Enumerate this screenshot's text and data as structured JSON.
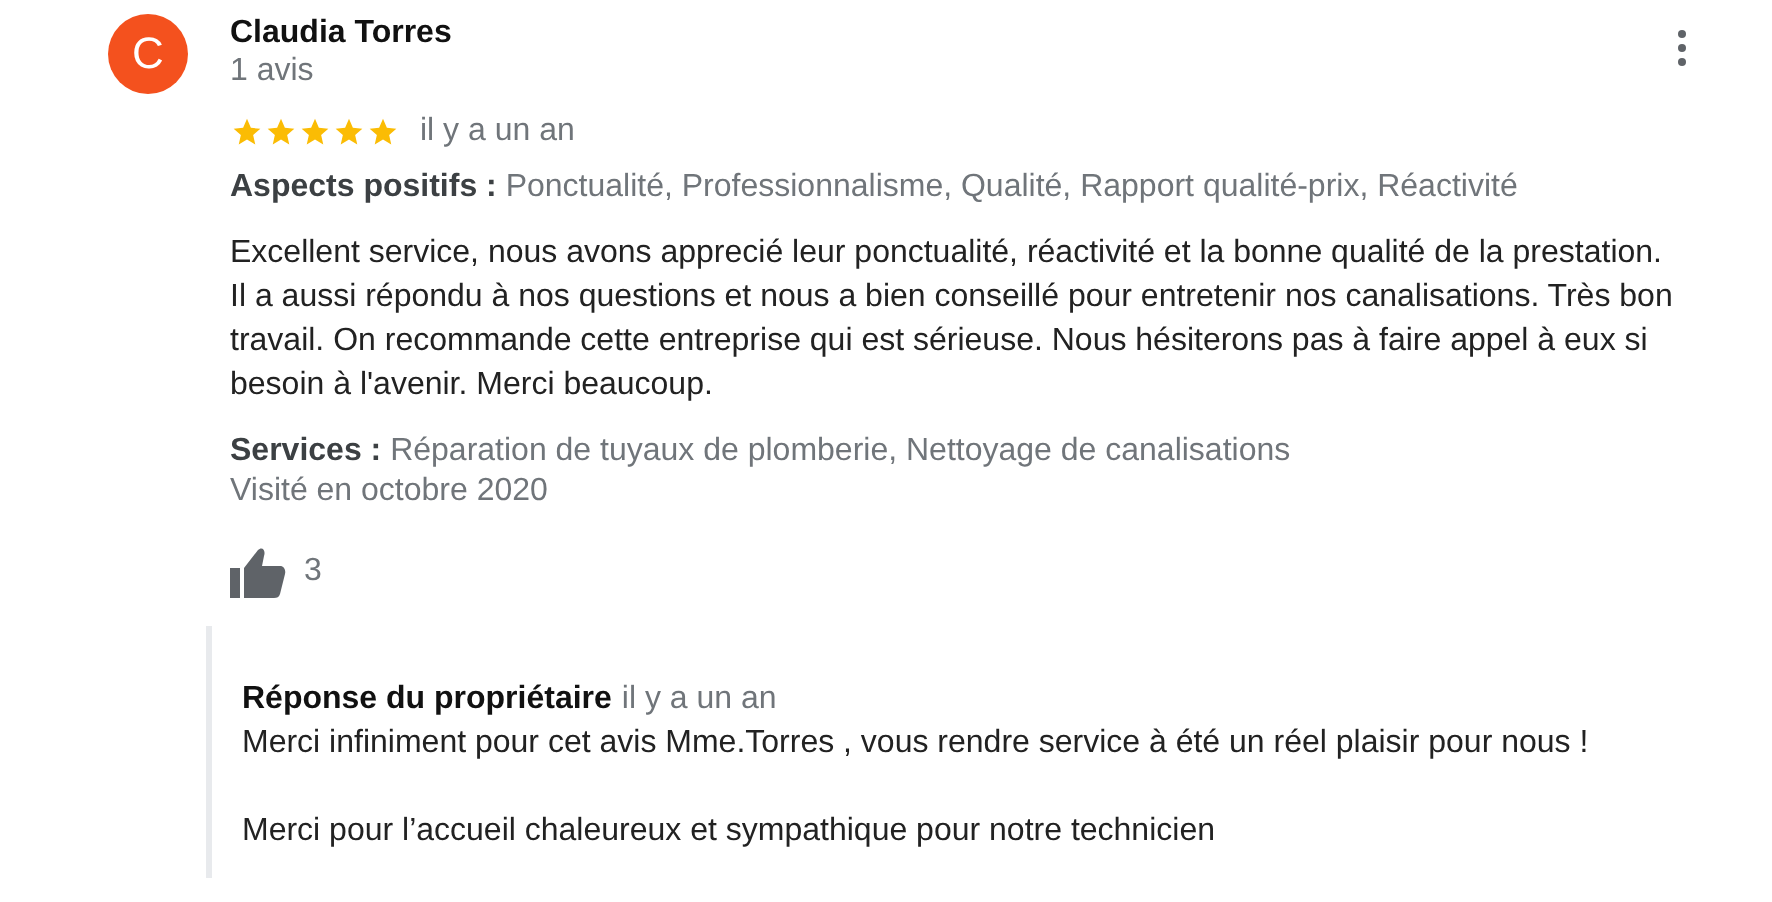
{
  "review": {
    "avatar_letter": "C",
    "author": "Claudia Torres",
    "review_count": "1 avis",
    "stars": 5,
    "time": "il y a un an",
    "positives": {
      "label": "Aspects positifs :",
      "value": "Ponctualité, Professionnalisme, Qualité, Rapport qualité-prix, Réactivité"
    },
    "text": "Excellent service, nous avons apprecié leur ponctualité, réactivité et la bonne qualité de la prestation. Il a aussi répondu à nos questions et nous a bien conseillé pour entretenir nos canalisations. Très bon travail. On recommande cette entreprise qui est sérieuse. Nous hésiterons pas à faire appel à eux si besoin à l'avenir. Merci beaucoup.",
    "services": {
      "label": "Services :",
      "value": "Réparation de tuyaux de plomberie, Nettoyage de canalisations"
    },
    "visited": "Visité en octobre 2020",
    "likes": "3"
  },
  "owner_reply": {
    "title": "Réponse du propriétaire",
    "time": "il y a un an",
    "paragraphs": [
      "Merci infiniment pour cet avis Mme.Torres , vous rendre service à été un réel plaisir pour nous !",
      "Merci pour l’accueil chaleureux et sympathique pour notre technicien"
    ]
  }
}
